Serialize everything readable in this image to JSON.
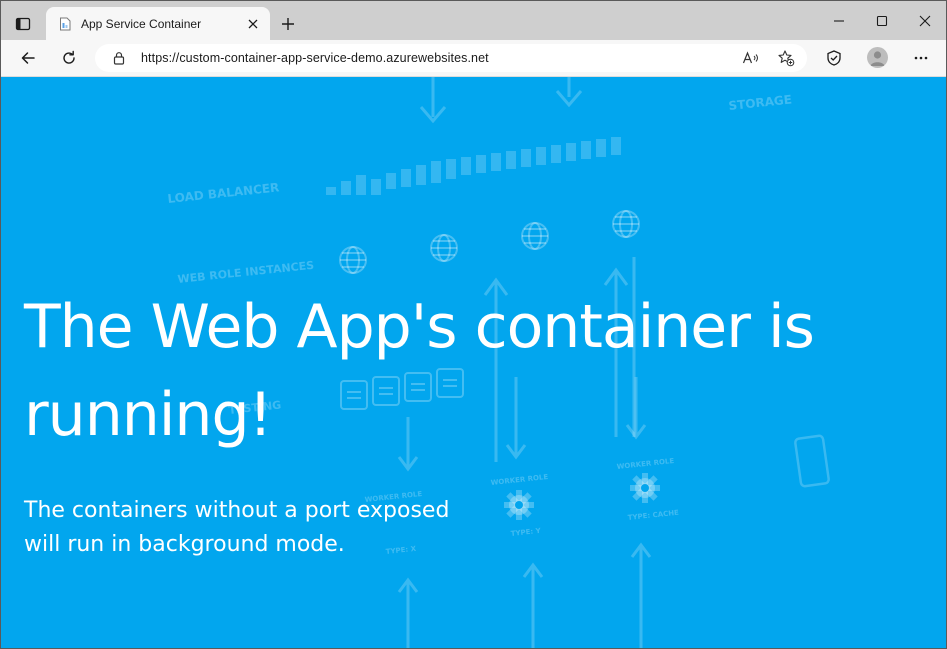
{
  "tab": {
    "title": "App Service Container",
    "favicon": "document-icon"
  },
  "address_bar": {
    "url": "https://custom-container-app-service-demo.azurewebsites.net"
  },
  "toolbar": {
    "icons": [
      "back-arrow-icon",
      "refresh-icon",
      "lock-icon",
      "read-aloud-icon",
      "add-favorite-icon",
      "browser-essentials-icon",
      "profile-avatar",
      "more-options-icon"
    ]
  },
  "window_controls": [
    "minimize-icon",
    "maximize-icon",
    "close-icon"
  ],
  "page": {
    "headline": "The Web App's container is running!",
    "subtext": "The containers without a port exposed will run in background mode.",
    "background_color": "#02a6ee",
    "illustration_labels": {
      "load_balancer": "LOAD BALANCER",
      "storage": "STORAGE",
      "web_role_instances": "WEB ROLE INSTANCES",
      "worker_role": "WORKER ROLE",
      "type_x": "TYPE: X",
      "type_y": "TYPE: Y",
      "type_cache": "TYPE: CACHE",
      "testing": "TESTING"
    }
  }
}
